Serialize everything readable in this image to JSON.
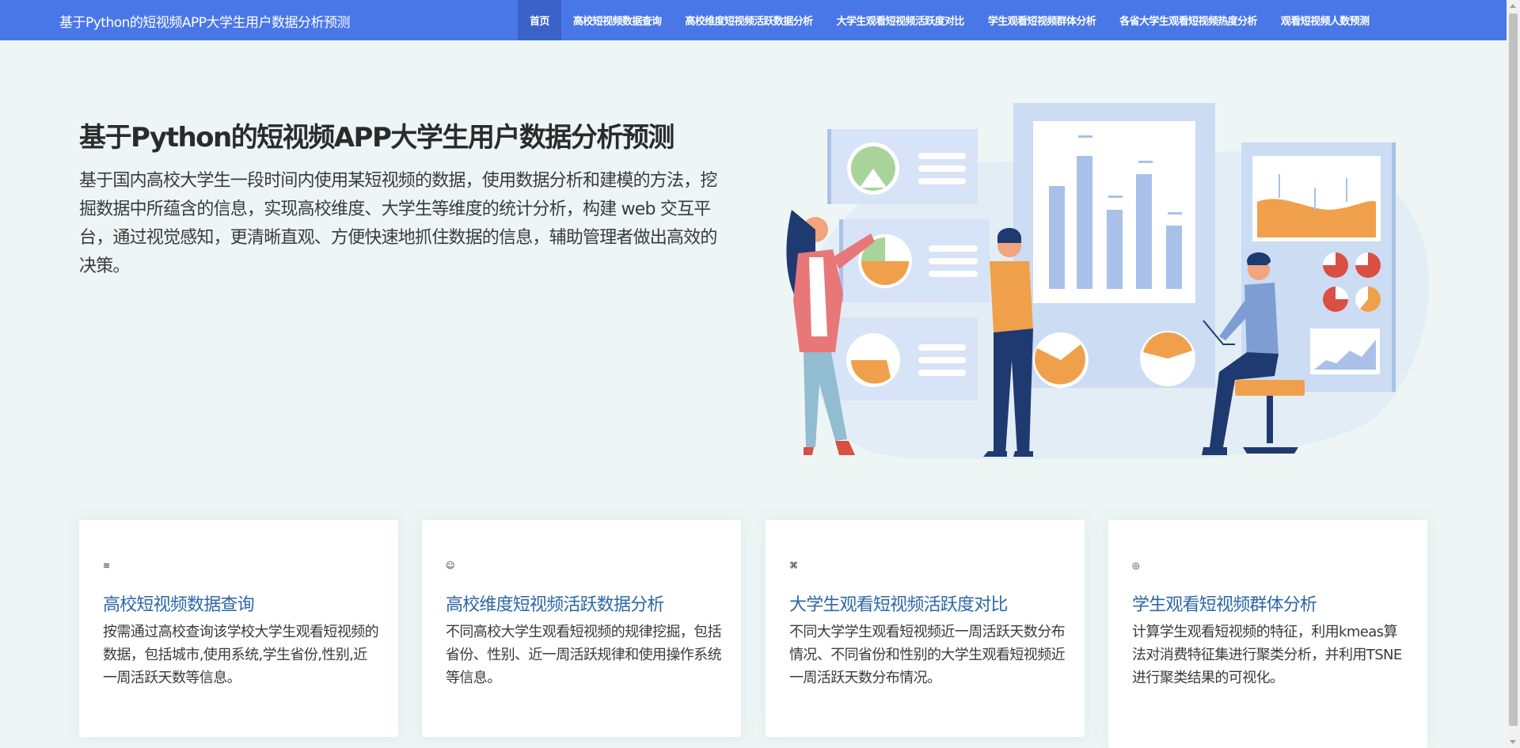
{
  "brand": "基于Python的短视频APP大学生用户数据分析预测",
  "nav": {
    "items": [
      "首页",
      "高校短视频数据查询",
      "高校维度短视频活跃数据分析",
      "大学生观看短视频活跃度对比",
      "学生观看短视频群体分析",
      "各省大学生观看短视频热度分析",
      "观看短视频人数预测"
    ]
  },
  "hero": {
    "title": "基于Python的短视频APP大学生用户数据分析预测",
    "description": "基于国内高校大学生一段时间内使用某短视频的数据，使用数据分析和建模的方法，挖掘数据中所蕴含的信息，实现高校维度、大学生等维度的统计分析，构建 web 交互平台，通过视觉感知，更清晰直观、方便快速地抓住数据的信息，辅助管理者做出高效的决策。"
  },
  "cards": [
    {
      "icon": "layers-icon",
      "glyph": "≋",
      "title": "高校短视频数据查询",
      "text": "按需通过高校查询该学校大学生观看短视频的数据，包括城市,使用系统,学生省份,性别,近一周活跃天数等信息。"
    },
    {
      "icon": "palette-icon",
      "glyph": "☺",
      "title": "高校维度短视频活跃数据分析",
      "text": "不同高校大学生观看短视频的规律挖掘，包括省份、性别、近一周活跃规律和使用操作系统等信息。"
    },
    {
      "icon": "command-icon",
      "glyph": "⌘",
      "title": "大学生观看短视频活跃度对比",
      "text": "不同大学学生观看短视频近一周活跃天数分布情况、不同省份和性别的大学生观看短视频近一周活跃天数分布情况。"
    },
    {
      "icon": "fingerprint-icon",
      "glyph": "◎",
      "title": "学生观看短视频群体分析",
      "text": "计算学生观看短视频的特征，利用kmeas算法对消费特征集进行聚类分析，并利用TSNE进行聚类结果的可视化。"
    }
  ],
  "colors": {
    "navbar": "#4a77e8",
    "nav_active": "#3c62c8",
    "background": "#edf6f5",
    "card_title": "#2e66a8"
  }
}
